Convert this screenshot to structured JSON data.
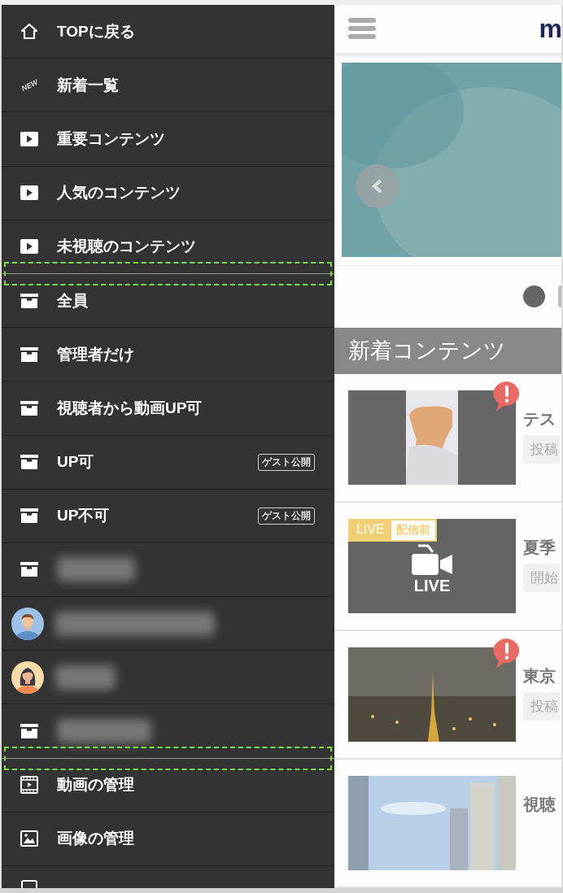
{
  "drawer": {
    "items": [
      {
        "kind": "text",
        "label": "TOPに戻る"
      },
      {
        "kind": "text",
        "icon_text": "NEW",
        "label": "新着一覧"
      },
      {
        "kind": "text",
        "label": "重要コンテンツ"
      },
      {
        "kind": "text",
        "label": "人気のコンテンツ"
      },
      {
        "kind": "text",
        "label": "未視聴のコンテンツ"
      },
      {
        "kind": "text",
        "label": "全員",
        "group_start": true
      },
      {
        "kind": "text",
        "label": "管理者だけ"
      },
      {
        "kind": "text",
        "label": "視聴者から動画UP可"
      },
      {
        "kind": "text",
        "label": "UP可",
        "badge": "ゲスト公開"
      },
      {
        "kind": "text",
        "label": "UP不可",
        "badge": "ゲスト公開"
      },
      {
        "kind": "blurred"
      },
      {
        "kind": "blurred"
      },
      {
        "kind": "blurred"
      },
      {
        "kind": "blurred"
      },
      {
        "kind": "text",
        "label": "動画の管理",
        "group_start": true
      },
      {
        "kind": "text",
        "label": "画像の管理"
      },
      {
        "kind": "icon-only"
      }
    ]
  },
  "header": {
    "logo": "m"
  },
  "pagination": [
    {
      "selected": true
    },
    {
      "selected": false
    }
  ],
  "section_title": "新着コンテンツ",
  "cards": [
    {
      "kind": "video",
      "title": "テス",
      "tag": "投稿",
      "alert": true
    },
    {
      "kind": "live",
      "live_badge": "LIVE",
      "status_badge": "配信前",
      "thumb_text": "LIVE",
      "title": "夏季",
      "tag": "開始",
      "alert": false
    },
    {
      "kind": "video",
      "title": "東京",
      "tag": "投稿",
      "alert": true
    },
    {
      "kind": "video",
      "title": "視聴",
      "alert": false
    }
  ]
}
